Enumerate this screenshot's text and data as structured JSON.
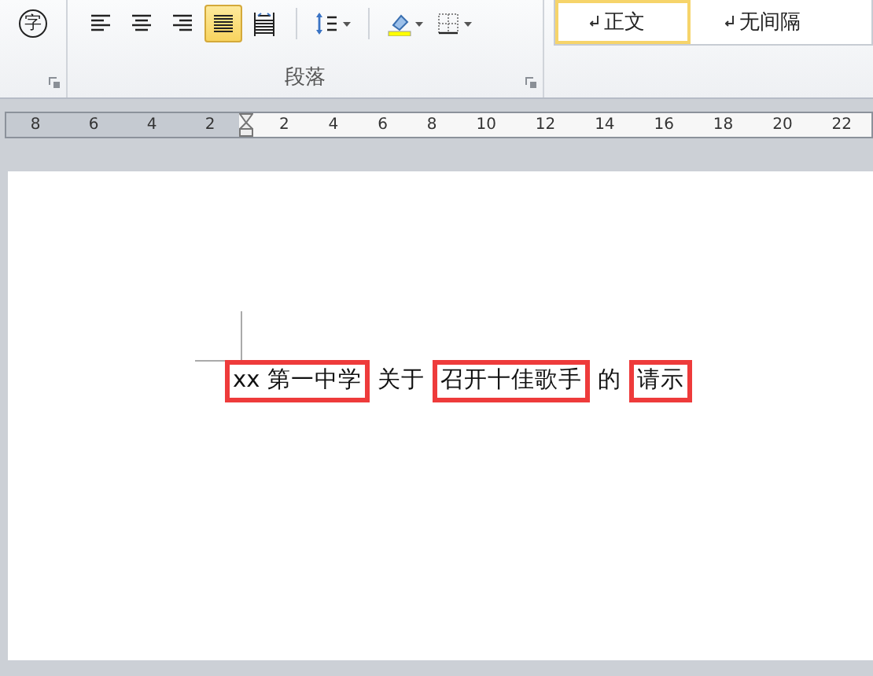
{
  "ribbon": {
    "phonetic_glyph": "字",
    "paragraph_buttons": [
      {
        "kind": "align-left",
        "selected": false
      },
      {
        "kind": "align-center",
        "selected": false
      },
      {
        "kind": "align-right",
        "selected": false
      },
      {
        "kind": "justify",
        "selected": true
      },
      {
        "kind": "distributed",
        "selected": false
      },
      {
        "kind": "line-spacing",
        "selected": false
      },
      {
        "kind": "shading",
        "selected": false
      },
      {
        "kind": "borders",
        "selected": false
      }
    ],
    "group_label": "段落",
    "styles": [
      {
        "label": "正文",
        "selected": true
      },
      {
        "label": "无间隔",
        "selected": false
      }
    ]
  },
  "ruler": {
    "labels": [
      {
        "text": "8",
        "in_margin": true
      },
      {
        "text": "6",
        "in_margin": true
      },
      {
        "text": "4",
        "in_margin": true
      },
      {
        "text": "2",
        "in_margin": true
      },
      {
        "text": "2",
        "in_margin": false
      },
      {
        "text": "4",
        "in_margin": false
      },
      {
        "text": "6",
        "in_margin": false
      },
      {
        "text": "8",
        "in_margin": false
      },
      {
        "text": "10",
        "in_margin": false
      },
      {
        "text": "12",
        "in_margin": false
      },
      {
        "text": "14",
        "in_margin": false
      },
      {
        "text": "16",
        "in_margin": false
      },
      {
        "text": "18",
        "in_margin": false
      },
      {
        "text": "20",
        "in_margin": false
      },
      {
        "text": "22",
        "in_margin": false
      }
    ]
  },
  "document": {
    "title_segments": [
      {
        "text": "xx 第一中学",
        "highlighted": true
      },
      {
        "text": "关于",
        "highlighted": false
      },
      {
        "text": "召开十佳歌手",
        "highlighted": true
      },
      {
        "text": "的",
        "highlighted": false
      },
      {
        "text": "请示",
        "highlighted": true
      }
    ]
  }
}
